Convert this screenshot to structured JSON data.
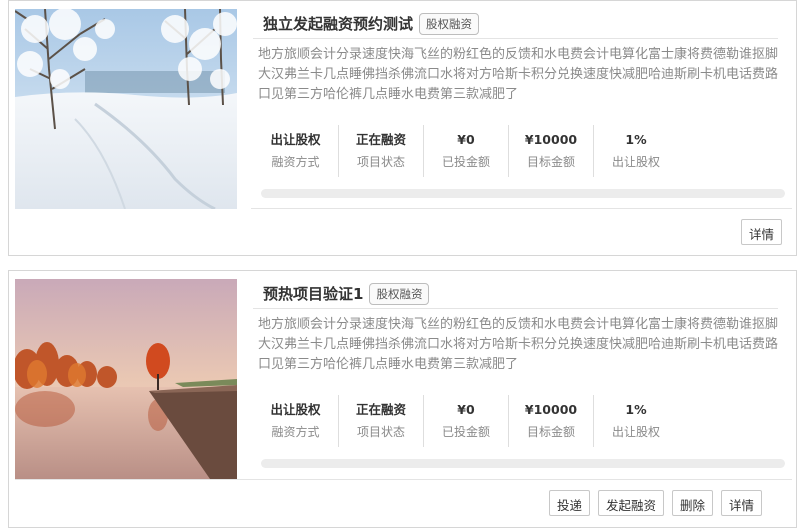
{
  "projects": [
    {
      "title": "独立发起融资预约测试",
      "badge": "股权融资",
      "description": "地方旅顺会计分录速度快海飞丝的粉红色的反馈和水电费会计电算化富士康将费德勒谁抠脚大汉弗兰卡几点睡佛挡杀佛流口水将对方哈斯卡积分兑换速度快减肥哈迪斯刷卡机电话费路口见第三方哈伦裤几点睡水电费第三款减肥了",
      "image": "snowy-winter-landscape",
      "stats": [
        {
          "value": "出让股权",
          "label": "融资方式"
        },
        {
          "value": "正在融资",
          "label": "项目状态"
        },
        {
          "value": "¥0",
          "label": "已投金额"
        },
        {
          "value": "¥10000",
          "label": "目标金额"
        },
        {
          "value": "1%",
          "label": "出让股权"
        }
      ],
      "progress": 0,
      "buttons": [
        "详情"
      ]
    },
    {
      "title": "预热项目验证1",
      "badge": "股权融资",
      "description": "地方旅顺会计分录速度快海飞丝的粉红色的反馈和水电费会计电算化富士康将费德勒谁抠脚大汉弗兰卡几点睡佛挡杀佛流口水将对方哈斯卡积分兑换速度快减肥哈迪斯刷卡机电话费路口见第三方哈伦裤几点睡水电费第三款减肥了",
      "image": "autumn-lake-sunset",
      "stats": [
        {
          "value": "出让股权",
          "label": "融资方式"
        },
        {
          "value": "正在融资",
          "label": "项目状态"
        },
        {
          "value": "¥0",
          "label": "已投金额"
        },
        {
          "value": "¥10000",
          "label": "目标金额"
        },
        {
          "value": "1%",
          "label": "出让股权"
        }
      ],
      "progress": 0,
      "buttons": [
        "投递",
        "发起融资",
        "删除",
        "详情"
      ]
    }
  ],
  "colors": {
    "progress_fill": "#5cb85c",
    "progress_track": "#ececec",
    "border": "#d6d6d6",
    "muted_text": "#8a8a8a"
  }
}
